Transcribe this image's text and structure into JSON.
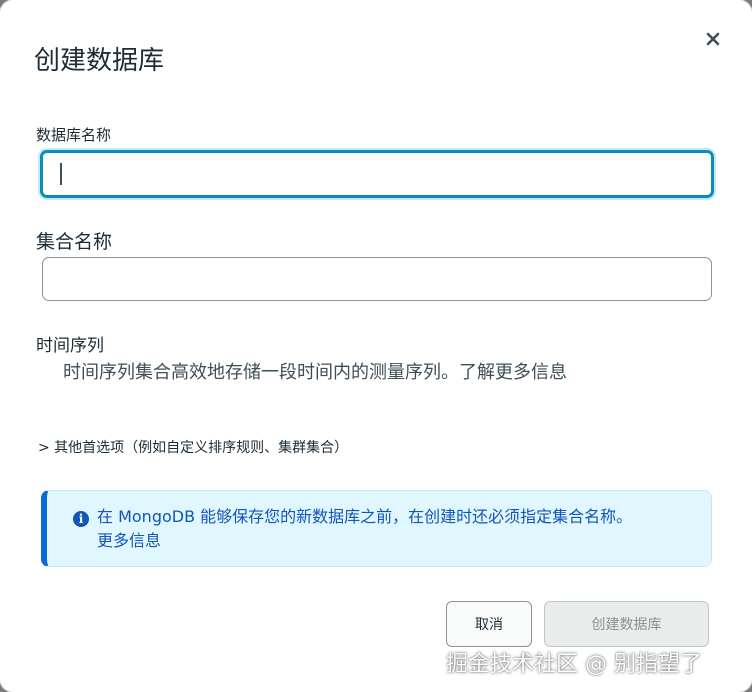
{
  "dialog": {
    "title": "创建数据库",
    "close_icon": "close-icon"
  },
  "fields": {
    "database_name_label": "数据库名称",
    "database_name_value": "",
    "collection_name_label": "集合名称",
    "collection_name_value": ""
  },
  "time_series": {
    "heading": "时间序列",
    "description": "时间序列集合高效地存储一段时间内的测量序列。",
    "learn_more": "了解更多信息"
  },
  "additional_options": {
    "label": "> 其他首选项（例如自定义排序规则、集群集合）"
  },
  "info_banner": {
    "icon": "info-icon",
    "text": "在 MongoDB 能够保存您的新数据库之前，在创建时还必须指定集合名称。",
    "link": "更多信息",
    "accent_color": "#0a6ad6",
    "background_color": "#e1f7ff"
  },
  "buttons": {
    "cancel": "取消",
    "create": "创建数据库"
  },
  "watermark": "掘金技术社区 @ 别指望了"
}
